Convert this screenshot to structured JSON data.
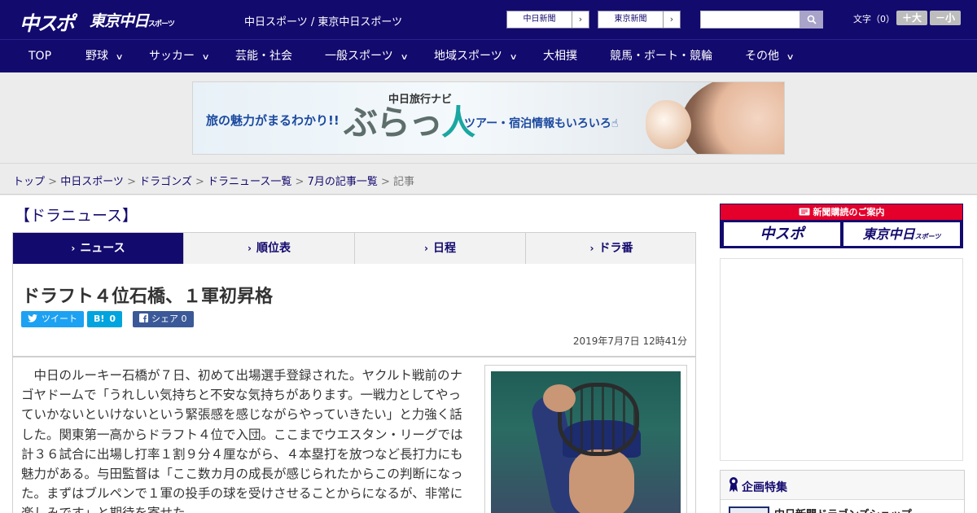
{
  "header": {
    "logo_main": "中スポ",
    "logo_tokyo": "東京中日",
    "logo_tokyo_suffix": "スポーツ",
    "site_title": "中日スポーツ / 東京中日スポーツ",
    "links": [
      {
        "label": "中日新聞",
        "arrow": "›"
      },
      {
        "label": "東京新聞",
        "arrow": "›"
      }
    ],
    "search_icon": "⚲",
    "font_size_label": "文字（0）",
    "font_plus": "＋大",
    "font_minus": "－小"
  },
  "nav": {
    "items": [
      {
        "label": "TOP",
        "has_menu": false
      },
      {
        "label": "野球",
        "has_menu": true
      },
      {
        "label": "サッカー",
        "has_menu": true
      },
      {
        "label": "芸能・社会",
        "has_menu": false
      },
      {
        "label": "一般スポーツ",
        "has_menu": true
      },
      {
        "label": "地域スポーツ",
        "has_menu": true
      },
      {
        "label": "大相撲",
        "has_menu": false
      },
      {
        "label": "競馬・ボート・競輪",
        "has_menu": false
      },
      {
        "label": "その他",
        "has_menu": true
      }
    ],
    "chevron": "∨"
  },
  "banner": {
    "tagline": "旅の魅力がまるわかり!!",
    "navi": "中日旅行ナビ",
    "brand_a": "ぶらっ",
    "brand_b": "人",
    "sub": "ツアー・宿泊情報もいろいろ☝"
  },
  "breadcrumb": {
    "items": [
      "トップ",
      "中日スポーツ",
      "ドラゴンズ",
      "ドラニュース一覧",
      "7月の記事一覧"
    ],
    "current": "記事",
    "separator": " > "
  },
  "section_title": "【ドラニュース】",
  "tabs": [
    {
      "label": "ニュース",
      "active": true
    },
    {
      "label": "順位表",
      "active": false
    },
    {
      "label": "日程",
      "active": false
    },
    {
      "label": "ドラ番",
      "active": false
    }
  ],
  "article": {
    "headline": "ドラフト４位石橋、１軍初昇格",
    "share": {
      "tweet_label": "ツイート",
      "hatena_label": "B!",
      "hatena_count": "0",
      "fb_label": "シェア",
      "fb_count": "0"
    },
    "date": "2019年7月7日 12時41分",
    "body": "中日のルーキー石橋が７日、初めて出場選手登録された。ヤクルト戦前のナゴヤドームで「うれしい気持ちと不安な気持ちがあります。一戦力としてやっていかないといけないという緊張感を感じながらやっていきたい」と力強く話した。関東第一高からドラフト４位で入団。ここまでウエスタン・リーグでは計３６試合に出場し打率１割９分４厘ながら、４本塁打を放つなど長打力にも魅力がある。与田監督は「ここ数カ月の成長が感じられたからこの判断になった。まずはブルペンで１軍の投手の球を受けさせることからになるが、非常に楽しみです」と期待を寄せた。"
  },
  "sidebar": {
    "subscribe_head": "新聞購読のご案内",
    "subscribe_logo_1": "中スポ",
    "subscribe_logo_2": "東京中日",
    "subscribe_logo_2_suffix": "スポーツ",
    "feature_title": "企画特集",
    "feature_item": "中日新聞ドラゴンズショップ"
  },
  "colors": {
    "brand_navy": "#130a6e",
    "tweet": "#1da1f2",
    "hatena": "#00a4de",
    "facebook": "#3b5998",
    "subscribe_red": "#e4002b"
  }
}
